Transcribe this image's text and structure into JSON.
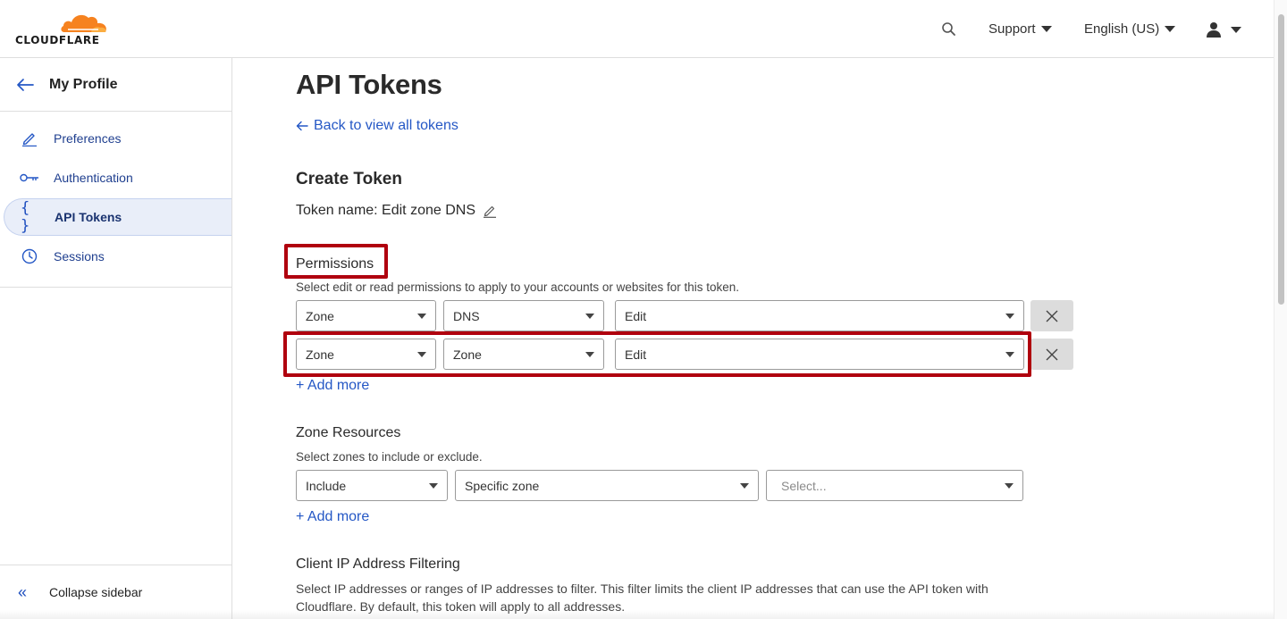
{
  "brand": {
    "logo_text": "CLOUDFLARE",
    "logo_color": "#f6821f"
  },
  "topbar": {
    "support_label": "Support",
    "language_label": "English (US)"
  },
  "sidebar": {
    "header_title": "My Profile",
    "items": [
      {
        "label": "Preferences",
        "icon": "pencil-icon",
        "active": false
      },
      {
        "label": "Authentication",
        "icon": "key-icon",
        "active": false
      },
      {
        "label": "API Tokens",
        "icon": "braces-icon",
        "active": true
      },
      {
        "label": "Sessions",
        "icon": "clock-icon",
        "active": false
      }
    ],
    "collapse_label": "Collapse sidebar"
  },
  "main": {
    "page_title": "API Tokens",
    "back_link": "Back to view all tokens",
    "section_title": "Create Token",
    "token_name_label": "Token name: Edit zone DNS",
    "permissions": {
      "label": "Permissions",
      "help": "Select edit or read permissions to apply to your accounts or websites for this token.",
      "rows": [
        {
          "scope": "Zone",
          "resource": "DNS",
          "access": "Edit"
        },
        {
          "scope": "Zone",
          "resource": "Zone",
          "access": "Edit"
        }
      ],
      "add_more": "+ Add more"
    },
    "zone_resources": {
      "label": "Zone Resources",
      "help": "Select zones to include or exclude.",
      "include": "Include",
      "zone_type": "Specific zone",
      "zone_placeholder": "Select...",
      "add_more": "+ Add more"
    },
    "ip_filtering": {
      "label": "Client IP Address Filtering",
      "help": "Select IP addresses or ranges of IP addresses to filter. This filter limits the client IP addresses that can use the API token with Cloudflare. By default, this token will apply to all addresses."
    }
  },
  "colors": {
    "accent": "#2457c5",
    "highlight": "#b0000e",
    "active_bg": "#e9eef9"
  }
}
